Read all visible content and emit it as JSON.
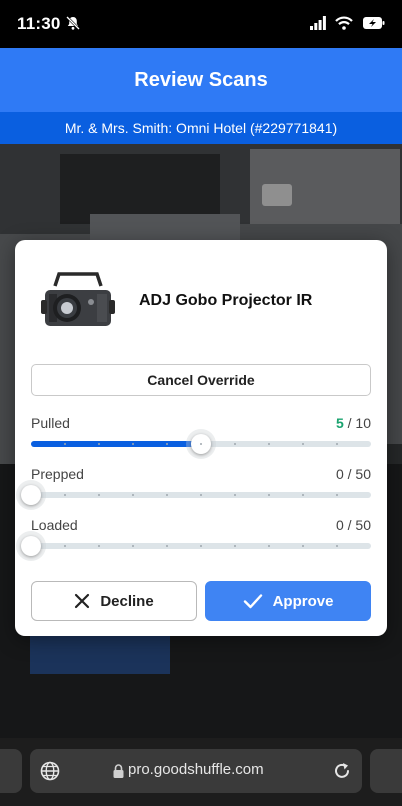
{
  "status_bar": {
    "time": "11:30"
  },
  "header": {
    "title": "Review Scans",
    "subtitle": "Mr. & Mrs. Smith: Omni Hotel (#229771841)"
  },
  "modal": {
    "product_name": "ADJ Gobo Projector IR",
    "override_label": "Cancel Override",
    "rows": [
      {
        "label": "Pulled",
        "current": "5",
        "separator": " / ",
        "total": "10",
        "fraction": 0.5
      },
      {
        "label": "Prepped",
        "current_text": "0 / 50",
        "fraction": 0
      },
      {
        "label": "Loaded",
        "current_text": "0 / 50",
        "fraction": 0
      }
    ],
    "decline_label": "Decline",
    "approve_label": "Approve"
  },
  "browser": {
    "url": "pro.goodshuffle.com"
  },
  "colors": {
    "header": "#2f7af5",
    "subheader": "#0a5fe0",
    "approve": "#3f84f3",
    "pulled_current": "#1aa36f"
  }
}
